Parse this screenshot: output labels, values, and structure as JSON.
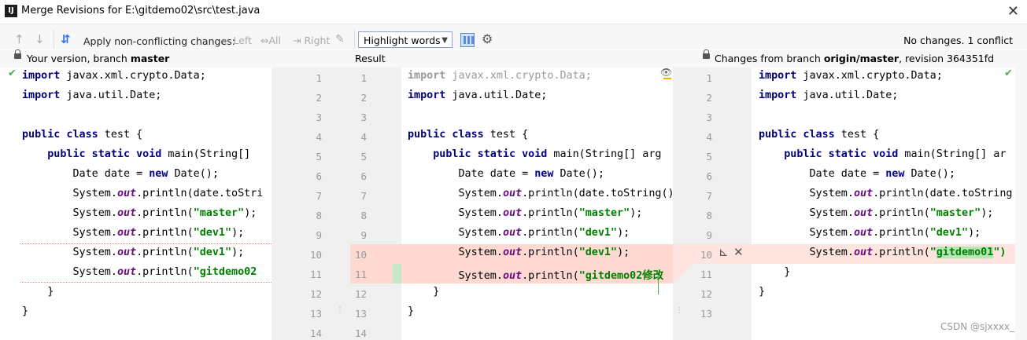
{
  "window": {
    "title": "Merge Revisions for E:\\gitdemo02\\src\\test.java",
    "app_icon": "IJ"
  },
  "toolbar": {
    "apply_label": "Apply non-conflicting changes:",
    "left_label": "Left",
    "all_label": "All",
    "right_label": "Right",
    "highlight_value": "Highlight words",
    "status": "No changes. 1 conflict"
  },
  "headers": {
    "left_prefix": "Your version, branch ",
    "left_branch": "master",
    "center": "Result",
    "right_prefix": "Changes from branch ",
    "right_branch": "origin/master",
    "right_suffix": ", revision 364351fd"
  },
  "line_numbers": {
    "left": [
      "1",
      "2",
      "3",
      "4",
      "5",
      "6",
      "7",
      "8",
      "9",
      "10",
      "11",
      "12",
      "13",
      "14"
    ],
    "center": [
      "1",
      "2",
      "3",
      "4",
      "5",
      "6",
      "7",
      "8",
      "9",
      "10",
      "11",
      "12",
      "13",
      "14"
    ],
    "right": [
      "1",
      "2",
      "3",
      "4",
      "5",
      "6",
      "7",
      "8",
      "9",
      "10",
      "11",
      "12",
      "13"
    ]
  },
  "code_left": [
    {
      "p": [
        {
          "t": "import",
          "c": "kw"
        },
        {
          "t": " javax.xml.crypto.Data;"
        }
      ]
    },
    {
      "p": [
        {
          "t": "import",
          "c": "kw"
        },
        {
          "t": " java.util.Date;"
        }
      ]
    },
    {
      "p": []
    },
    {
      "p": [
        {
          "t": "public class",
          "c": "kw"
        },
        {
          "t": " test {"
        }
      ]
    },
    {
      "p": [
        {
          "t": "    "
        },
        {
          "t": "public static void",
          "c": "kw"
        },
        {
          "t": " main(String[]"
        }
      ]
    },
    {
      "p": [
        {
          "t": "        Date date = "
        },
        {
          "t": "new",
          "c": "kw"
        },
        {
          "t": " Date();"
        }
      ]
    },
    {
      "p": [
        {
          "t": "        System."
        },
        {
          "t": "out",
          "c": "fld"
        },
        {
          "t": ".println(date.toStri"
        }
      ]
    },
    {
      "p": [
        {
          "t": "        System."
        },
        {
          "t": "out",
          "c": "fld"
        },
        {
          "t": ".println("
        },
        {
          "t": "\"master\"",
          "c": "str"
        },
        {
          "t": ");"
        }
      ]
    },
    {
      "p": [
        {
          "t": "        System."
        },
        {
          "t": "out",
          "c": "fld"
        },
        {
          "t": ".println("
        },
        {
          "t": "\"dev1\"",
          "c": "str"
        },
        {
          "t": ");"
        }
      ]
    },
    {
      "p": [
        {
          "t": "        System."
        },
        {
          "t": "out",
          "c": "fld"
        },
        {
          "t": ".println("
        },
        {
          "t": "\"dev1\"",
          "c": "str"
        },
        {
          "t": ");"
        }
      ]
    },
    {
      "p": [
        {
          "t": "        System."
        },
        {
          "t": "out",
          "c": "fld"
        },
        {
          "t": ".println("
        },
        {
          "t": "\"gitdemo02",
          "c": "str"
        }
      ]
    },
    {
      "p": [
        {
          "t": "    }"
        }
      ]
    },
    {
      "p": [
        {
          "t": "}"
        }
      ]
    },
    {
      "p": []
    }
  ],
  "code_center": [
    {
      "p": [
        {
          "t": "import",
          "c": "kw grey"
        },
        {
          "t": " javax.xml.crypto.Data;",
          "c": "grey"
        }
      ]
    },
    {
      "p": [
        {
          "t": "import",
          "c": "kw"
        },
        {
          "t": " java.util.Date;"
        }
      ]
    },
    {
      "p": []
    },
    {
      "p": [
        {
          "t": "public class",
          "c": "kw"
        },
        {
          "t": " test {"
        }
      ]
    },
    {
      "p": [
        {
          "t": "    "
        },
        {
          "t": "public static void",
          "c": "kw"
        },
        {
          "t": " main(String[] arg"
        }
      ]
    },
    {
      "p": [
        {
          "t": "        Date date = "
        },
        {
          "t": "new",
          "c": "kw"
        },
        {
          "t": " Date();"
        }
      ]
    },
    {
      "p": [
        {
          "t": "        System."
        },
        {
          "t": "out",
          "c": "fld"
        },
        {
          "t": ".println(date.toString()"
        }
      ]
    },
    {
      "p": [
        {
          "t": "        System."
        },
        {
          "t": "out",
          "c": "fld"
        },
        {
          "t": ".println("
        },
        {
          "t": "\"master\"",
          "c": "str"
        },
        {
          "t": ");"
        }
      ]
    },
    {
      "p": [
        {
          "t": "        System."
        },
        {
          "t": "out",
          "c": "fld"
        },
        {
          "t": ".println("
        },
        {
          "t": "\"dev1\"",
          "c": "str"
        },
        {
          "t": ");"
        }
      ]
    },
    {
      "p": [
        {
          "t": "        System."
        },
        {
          "t": "out",
          "c": "fld"
        },
        {
          "t": ".println("
        },
        {
          "t": "\"dev1\"",
          "c": "str"
        },
        {
          "t": ");"
        }
      ]
    },
    {
      "p": [
        {
          "t": "        System."
        },
        {
          "t": "out",
          "c": "fld"
        },
        {
          "t": ".println("
        },
        {
          "t": "\"gitdemo02修改",
          "c": "str"
        }
      ]
    },
    {
      "p": [
        {
          "t": "    }"
        }
      ]
    },
    {
      "p": [
        {
          "t": "}"
        }
      ]
    },
    {
      "p": []
    }
  ],
  "code_right": [
    {
      "p": [
        {
          "t": "import",
          "c": "kw"
        },
        {
          "t": " javax.xml.crypto.Data;"
        }
      ]
    },
    {
      "p": [
        {
          "t": "import",
          "c": "kw"
        },
        {
          "t": " java.util.Date;"
        }
      ]
    },
    {
      "p": []
    },
    {
      "p": [
        {
          "t": "public class",
          "c": "kw"
        },
        {
          "t": " test {"
        }
      ]
    },
    {
      "p": [
        {
          "t": "    "
        },
        {
          "t": "public static void",
          "c": "kw"
        },
        {
          "t": " main(String[] ar"
        }
      ]
    },
    {
      "p": [
        {
          "t": "        Date date = "
        },
        {
          "t": "new",
          "c": "kw"
        },
        {
          "t": " Date();"
        }
      ]
    },
    {
      "p": [
        {
          "t": "        System."
        },
        {
          "t": "out",
          "c": "fld"
        },
        {
          "t": ".println(date.toString"
        }
      ]
    },
    {
      "p": [
        {
          "t": "        System."
        },
        {
          "t": "out",
          "c": "fld"
        },
        {
          "t": ".println("
        },
        {
          "t": "\"master\"",
          "c": "str"
        },
        {
          "t": ");"
        }
      ]
    },
    {
      "p": [
        {
          "t": "        System."
        },
        {
          "t": "out",
          "c": "fld"
        },
        {
          "t": ".println("
        },
        {
          "t": "\"dev1\"",
          "c": "str"
        },
        {
          "t": ");"
        }
      ]
    },
    {
      "p": [
        {
          "t": "        System."
        },
        {
          "t": "out",
          "c": "fld"
        },
        {
          "t": ".println("
        },
        {
          "t": "\"",
          "c": "str"
        },
        {
          "t": "gitdemo01",
          "c": "str hl-str"
        },
        {
          "t": "\")",
          "c": "str"
        }
      ]
    },
    {
      "p": [
        {
          "t": "    }"
        }
      ]
    },
    {
      "p": [
        {
          "t": "}"
        }
      ]
    },
    {
      "p": []
    }
  ],
  "watermark": "CSDN @sjxxxx_",
  "colors": {
    "conflict": "#fdd9d1",
    "accent": "#5b8ed6",
    "check": "#4caf50"
  }
}
